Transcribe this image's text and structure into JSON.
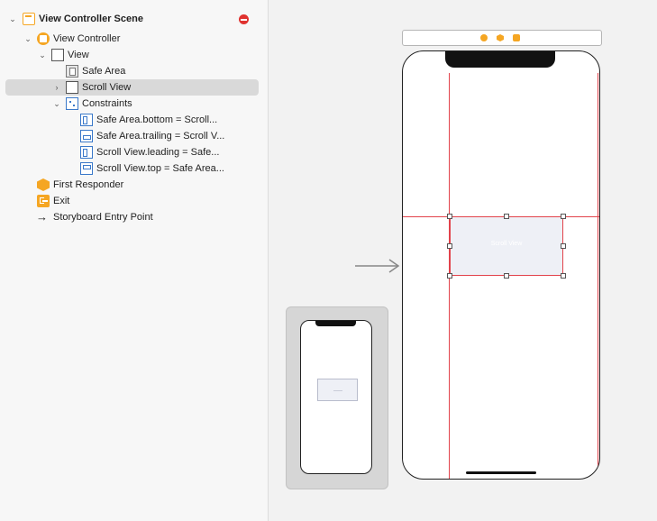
{
  "outline": {
    "scene_title": "View Controller Scene",
    "items": [
      {
        "label": "View Controller"
      },
      {
        "label": "View"
      },
      {
        "label": "Safe Area"
      },
      {
        "label": "Scroll View"
      },
      {
        "label": "Constraints"
      },
      {
        "label": "Safe Area.bottom = Scroll..."
      },
      {
        "label": "Safe Area.trailing = Scroll V..."
      },
      {
        "label": "Scroll View.leading = Safe..."
      },
      {
        "label": "Scroll View.top = Safe Area..."
      },
      {
        "label": "First Responder"
      },
      {
        "label": "Exit"
      },
      {
        "label": "Storyboard Entry Point"
      }
    ]
  },
  "canvas": {
    "selected_view_label": "Scroll View"
  },
  "colors": {
    "accent_orange": "#f5a623",
    "constraint_red": "#e2434b",
    "selection_bg": "#d9d9d9",
    "icon_blue": "#3a78c9"
  },
  "icons": [
    "scene-icon",
    "view-controller-icon",
    "view-icon",
    "safe-area-icon",
    "scroll-view-icon",
    "constraints-icon",
    "constraint-icon",
    "first-responder-icon",
    "exit-icon",
    "entry-point-arrow-icon",
    "error-icon"
  ]
}
